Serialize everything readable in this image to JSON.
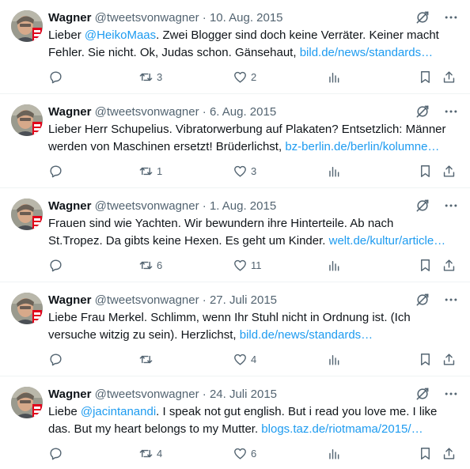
{
  "colors": {
    "link": "#1d9bf0",
    "text": "#0f1419",
    "muted": "#536471",
    "divider": "#eff3f4"
  },
  "icons": {
    "grok": "grok-icon",
    "more": "more-icon",
    "reply": "reply-icon",
    "retweet": "retweet-icon",
    "like": "like-icon",
    "views": "views-icon",
    "bookmark": "bookmark-icon",
    "share": "share-icon"
  },
  "tweets": [
    {
      "name": "Wagner",
      "handle": "@tweetsvonwagner",
      "sep": "·",
      "date": "10. Aug. 2015",
      "t1": "Lieber ",
      "mention": "@HeikoMaas",
      "t2": ". Zwei Blogger sind doch keine Verräter. Keiner macht Fehler. Sie nicht. Ok, Judas schon. Gänsehaut, ",
      "link": "bild.de/news/standards…",
      "replies": "",
      "retweets": "3",
      "likes": "2"
    },
    {
      "name": "Wagner",
      "handle": "@tweetsvonwagner",
      "sep": "·",
      "date": "6. Aug. 2015",
      "t1": "Lieber Herr Schupelius. Vibratorwerbung auf Plakaten? Entsetzlich: Männer werden von Maschinen ersetzt! Brüderlichst, ",
      "mention": "",
      "t2": "",
      "link": "bz-berlin.de/berlin/kolumne…",
      "replies": "",
      "retweets": "1",
      "likes": "3"
    },
    {
      "name": "Wagner",
      "handle": "@tweetsvonwagner",
      "sep": "·",
      "date": "1. Aug. 2015",
      "t1": "Frauen sind wie Yachten. Wir bewundern ihre Hinterteile. Ab nach St.Tropez. Da gibts keine Hexen. Es geht um Kinder.  ",
      "mention": "",
      "t2": "",
      "link": "welt.de/kultur/article…",
      "replies": "",
      "retweets": "6",
      "likes": "11"
    },
    {
      "name": "Wagner",
      "handle": "@tweetsvonwagner",
      "sep": "·",
      "date": "27. Juli 2015",
      "t1": "Liebe Frau Merkel. Schlimm, wenn Ihr Stuhl nicht in Ordnung ist. (Ich versuche witzig zu sein). Herzlichst, ",
      "mention": "",
      "t2": "",
      "link": "bild.de/news/standards…",
      "replies": "",
      "retweets": "",
      "likes": "4"
    },
    {
      "name": "Wagner",
      "handle": "@tweetsvonwagner",
      "sep": "·",
      "date": "24. Juli 2015",
      "t1": "Liebe ",
      "mention": "@jacintanandi",
      "t2": ". I speak not gut english. But i read you love me. I like das. But my heart belongs to my Mutter. ",
      "link": "blogs.taz.de/riotmama/2015/…",
      "replies": "",
      "retweets": "4",
      "likes": "6"
    }
  ]
}
